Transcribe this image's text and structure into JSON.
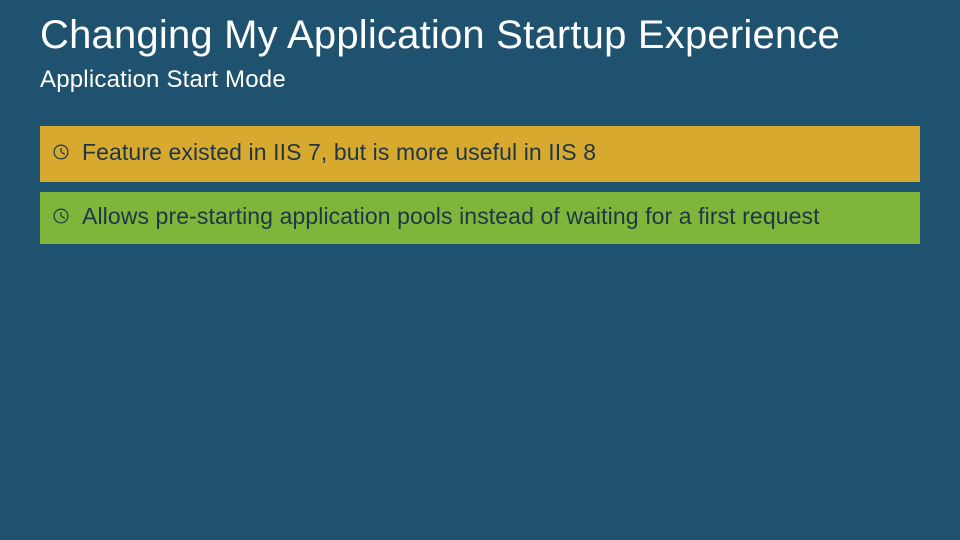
{
  "title": "Changing My Application Startup Experience",
  "subtitle": "Application Start Mode",
  "bullets": [
    {
      "text": "Feature existed in IIS 7, but is more useful in IIS 8"
    },
    {
      "text": "Allows pre-starting application pools instead of waiting for a first request"
    }
  ],
  "colors": {
    "background": "#1f526f",
    "bar1": "#d7a92f",
    "bar2": "#7fb53b",
    "bulletIcon": "#1f3646",
    "bulletText": "#1f3646",
    "title": "#ffffff"
  }
}
